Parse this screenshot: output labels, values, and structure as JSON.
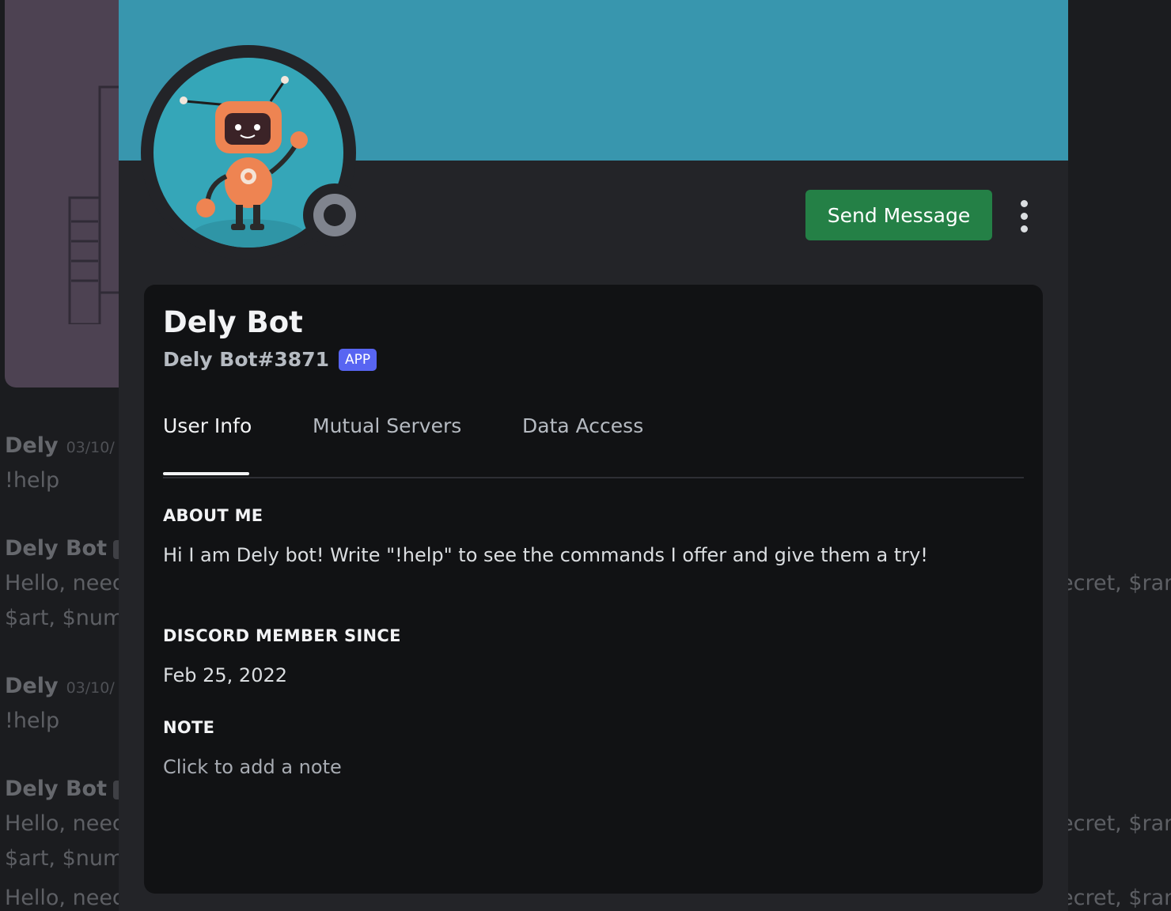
{
  "background_chat": {
    "messages": [
      {
        "author": "Dely",
        "timestamp": "03/10/",
        "text": "!help"
      },
      {
        "author": "Dely Bot",
        "text": "Hello, need",
        "text2": "$art, $num",
        "right_text": "ecret, $ran"
      },
      {
        "author": "Dely",
        "timestamp": "03/10/",
        "text": "!help"
      },
      {
        "author": "Dely Bot",
        "text": "Hello, need",
        "text2": "$art, $num",
        "right_text": "ecret, $ran"
      }
    ],
    "trailing_text": "Hello, need",
    "trailing_right": "ecret, $ran"
  },
  "profile": {
    "banner_color": "#3896ae",
    "avatar_icon": "robot-avatar",
    "status_icon": "offline-status-icon",
    "send_message_label": "Send Message",
    "more_icon": "more-vertical-icon",
    "display_name": "Dely Bot",
    "username": "Dely Bot#3871",
    "badge": "APP",
    "badge_color": "#5865f2",
    "send_button_color": "#248046",
    "tabs": [
      {
        "label": "User Info",
        "active": true
      },
      {
        "label": "Mutual Servers",
        "active": false
      },
      {
        "label": "Data Access",
        "active": false
      }
    ],
    "about_me_heading": "ABOUT ME",
    "about_me_text": "Hi I am Dely bot! Write \"!help\" to see the commands I offer and give them a try!",
    "member_since_heading": "DISCORD MEMBER SINCE",
    "member_since_text": "Feb 25, 2022",
    "note_heading": "NOTE",
    "note_placeholder": "Click to add a note"
  }
}
